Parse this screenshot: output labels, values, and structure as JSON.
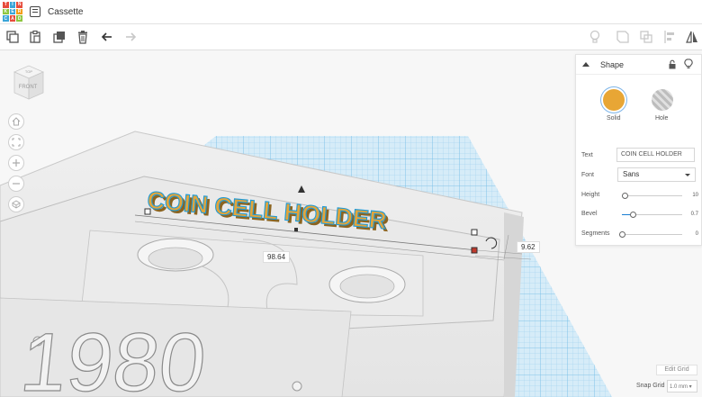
{
  "app": {
    "title": "Cassette",
    "logo_letters": [
      "T",
      "I",
      "N",
      "K",
      "E",
      "R",
      "C",
      "A",
      "D"
    ],
    "logo_colors": [
      "#e74c3c",
      "#3aa5d8",
      "#e74c3c",
      "#8dc63f",
      "#3aa5d8",
      "#f39c12",
      "#3aa5d8",
      "#e74c3c",
      "#8dc63f"
    ]
  },
  "toolbar": {
    "left_icons": [
      "copy-icon",
      "paste-icon",
      "duplicate-icon",
      "delete-icon",
      "undo-icon",
      "redo-icon"
    ],
    "right_icons": [
      "light-bulb-icon",
      "group-icon",
      "ungroup-icon",
      "align-icon",
      "mirror-icon"
    ]
  },
  "viewcube": {
    "label": "FRONT",
    "top_label": "TOP"
  },
  "side_tools": [
    "home-icon",
    "fit-view-icon",
    "zoom-in-icon",
    "zoom-out-icon",
    "perspective-icon"
  ],
  "model": {
    "text": "COIN CELL HOLDER",
    "year": "1980",
    "width_dimension": "98.64",
    "height_dimension": "9.62"
  },
  "shape_panel": {
    "title": "Shape",
    "solid_label": "Solid",
    "hole_label": "Hole",
    "solid_color": "#e8a635",
    "props": {
      "text_label": "Text",
      "text_value": "COIN CELL HOLDER",
      "font_label": "Font",
      "font_value": "Sans",
      "height_label": "Height",
      "height_value": "10",
      "height_fraction": 0.05,
      "bevel_label": "Bevel",
      "bevel_value": "0.7",
      "bevel_fraction": 0.18,
      "segments_label": "Segments",
      "segments_value": "0",
      "segments_fraction": 0
    }
  },
  "bottom": {
    "edit_grid_label": "Edit Grid",
    "snap_grid_label": "Snap Grid",
    "snap_grid_value": "1.0 mm"
  }
}
